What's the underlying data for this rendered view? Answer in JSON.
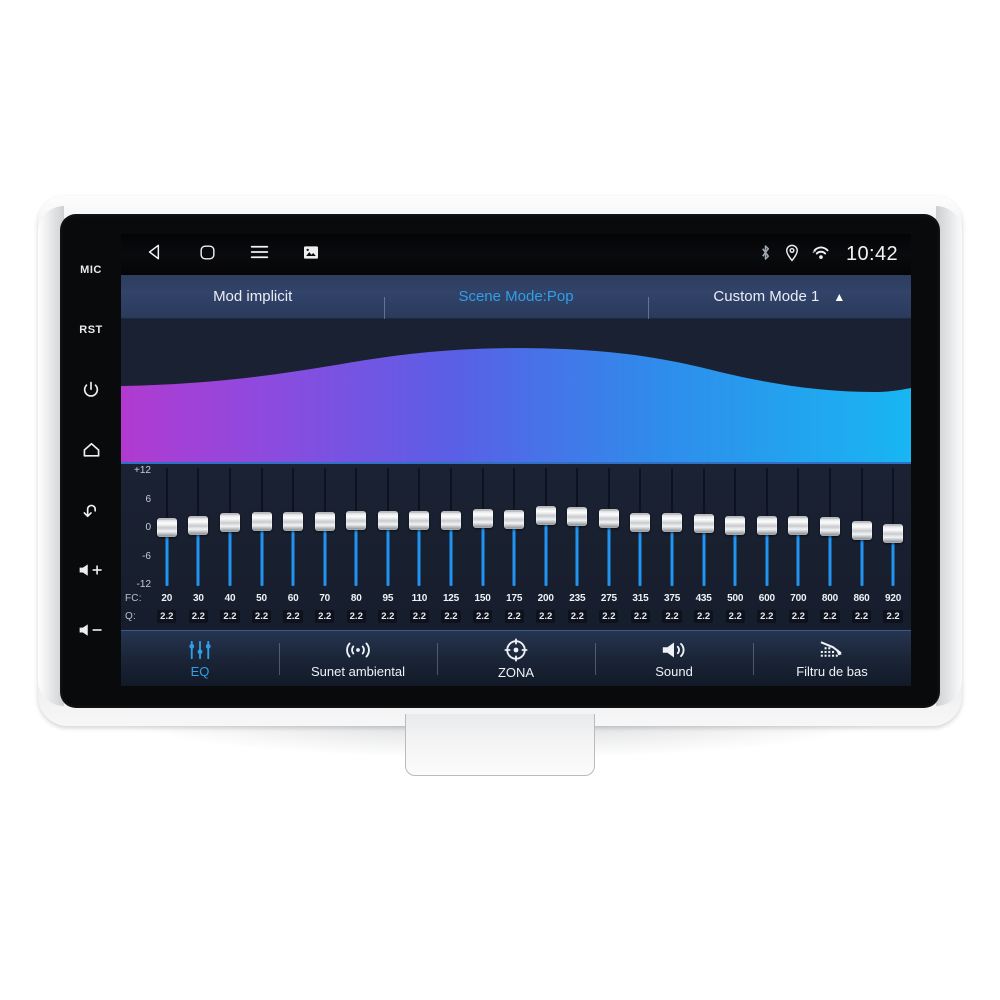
{
  "device": {
    "hard_keys": [
      {
        "name": "mic",
        "label": "MIC"
      },
      {
        "name": "reset",
        "label": "RST"
      },
      {
        "name": "power",
        "label": ""
      },
      {
        "name": "home",
        "label": ""
      },
      {
        "name": "back",
        "label": ""
      },
      {
        "name": "volume-up",
        "label": ""
      },
      {
        "name": "volume-down",
        "label": ""
      }
    ]
  },
  "statusbar": {
    "nav": [
      {
        "name": "back",
        "icon": "triangle-left-icon"
      },
      {
        "name": "home",
        "icon": "rounded-square-icon"
      },
      {
        "name": "menu",
        "icon": "hamburger-icon"
      },
      {
        "name": "screenshot",
        "icon": "image-icon"
      }
    ],
    "icons": [
      "bluetooth-icon",
      "location-pin-icon",
      "wifi-icon"
    ],
    "clock": "10:42"
  },
  "modebar": {
    "modes": [
      {
        "label": "Mod implicit",
        "active": false,
        "caret": ""
      },
      {
        "label": "Scene Mode:Pop",
        "active": true,
        "caret": ""
      },
      {
        "label": "Custom Mode 1",
        "active": false,
        "caret": "▲"
      }
    ]
  },
  "equalizer": {
    "axis_labels": [
      "+12",
      "6",
      "0",
      "-6",
      "-12"
    ],
    "fc_label": "FC:",
    "q_label": "Q:",
    "range_db": [
      -12,
      12
    ],
    "bands": [
      {
        "fc": "20",
        "q": "2.2",
        "gain": 0.0
      },
      {
        "fc": "30",
        "q": "2.2",
        "gain": 0.4
      },
      {
        "fc": "40",
        "q": "2.2",
        "gain": 0.9
      },
      {
        "fc": "50",
        "q": "2.2",
        "gain": 1.1
      },
      {
        "fc": "60",
        "q": "2.2",
        "gain": 1.1
      },
      {
        "fc": "70",
        "q": "2.2",
        "gain": 1.2
      },
      {
        "fc": "80",
        "q": "2.2",
        "gain": 1.3
      },
      {
        "fc": "95",
        "q": "2.2",
        "gain": 1.3
      },
      {
        "fc": "110",
        "q": "2.2",
        "gain": 1.4
      },
      {
        "fc": "125",
        "q": "2.2",
        "gain": 1.4
      },
      {
        "fc": "150",
        "q": "2.2",
        "gain": 1.7
      },
      {
        "fc": "175",
        "q": "2.2",
        "gain": 1.6
      },
      {
        "fc": "200",
        "q": "2.2",
        "gain": 2.3
      },
      {
        "fc": "235",
        "q": "2.2",
        "gain": 2.2
      },
      {
        "fc": "275",
        "q": "2.2",
        "gain": 1.8
      },
      {
        "fc": "315",
        "q": "2.2",
        "gain": 1.0
      },
      {
        "fc": "375",
        "q": "2.2",
        "gain": 0.9
      },
      {
        "fc": "435",
        "q": "2.2",
        "gain": 0.7
      },
      {
        "fc": "500",
        "q": "2.2",
        "gain": 0.4
      },
      {
        "fc": "600",
        "q": "2.2",
        "gain": 0.3
      },
      {
        "fc": "700",
        "q": "2.2",
        "gain": 0.3
      },
      {
        "fc": "800",
        "q": "2.2",
        "gain": 0.2
      },
      {
        "fc": "860",
        "q": "2.2",
        "gain": -0.8
      },
      {
        "fc": "920",
        "q": "2.2",
        "gain": -1.4
      }
    ]
  },
  "curve": {
    "gradient_start": "#b13ad0",
    "gradient_mid": "#4f63e8",
    "gradient_end": "#18b6f2",
    "background": "#1a2133"
  },
  "tabbar": {
    "tabs": [
      {
        "label": "EQ",
        "icon": "equalizer-sliders-icon",
        "active": true
      },
      {
        "label": "Sunet ambiental",
        "icon": "surround-sound-icon",
        "active": false
      },
      {
        "label": "ZONA",
        "icon": "zone-crosshair-icon",
        "active": false
      },
      {
        "label": "Sound",
        "icon": "speaker-icon",
        "active": false
      },
      {
        "label": "Filtru de bas",
        "icon": "bass-filter-icon",
        "active": false
      }
    ]
  }
}
